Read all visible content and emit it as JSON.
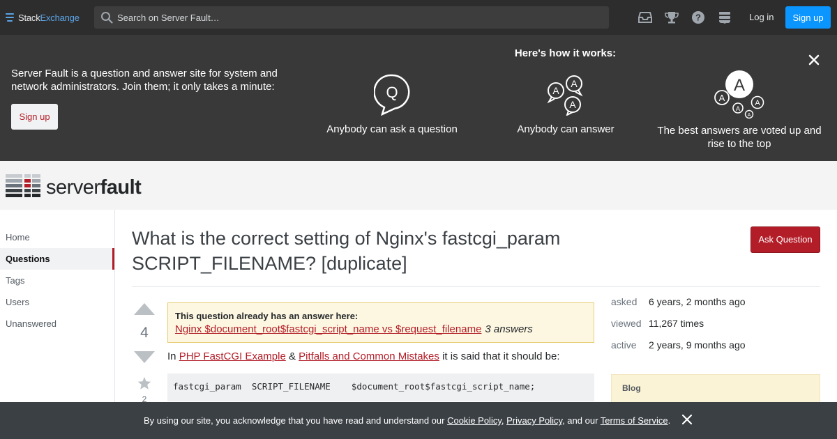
{
  "topbar": {
    "logo_stack": "Stack",
    "logo_exchange": "Exchange",
    "search_placeholder": "Search on Server Fault…",
    "icons": [
      "inbox-icon",
      "achievements-icon",
      "help-icon",
      "site-switcher-icon"
    ],
    "login_label": "Log in",
    "signup_label": "Sign up"
  },
  "hero": {
    "intro": "Server Fault is a question and answer site for system and network administrators. Join them; it only takes a minute:",
    "signup_label": "Sign up",
    "heading": "Here's how it works:",
    "steps": [
      {
        "icon": "ask-question-icon",
        "glyph": "Q",
        "label": "Anybody can ask a question"
      },
      {
        "icon": "answer-icon",
        "glyph": "A",
        "label": "Anybody can answer"
      },
      {
        "icon": "voted-answer-icon",
        "glyph": "A",
        "label": "The best answers are voted up and rise to the top"
      }
    ]
  },
  "site": {
    "name_light": "server",
    "name_bold": "fault"
  },
  "nav": {
    "items": [
      {
        "label": "Home",
        "active": false
      },
      {
        "label": "Questions",
        "active": true
      },
      {
        "label": "Tags",
        "active": false
      },
      {
        "label": "Users",
        "active": false
      },
      {
        "label": "Unanswered",
        "active": false
      }
    ]
  },
  "question": {
    "title": "What is the correct setting of Nginx's fastcgi_param SCRIPT_FILENAME? [duplicate]",
    "ask_button": "Ask Question",
    "votes": "4",
    "favorites": "2",
    "duplicate": {
      "heading": "This question already has an answer here:",
      "link": "Nginx $document_root$fastcgi_script_name vs $request_filename",
      "answers": "3 answers"
    },
    "body": {
      "prefix": "In",
      "link1": "PHP FastCGI Example",
      "amp": "&",
      "link2": "Pitfalls and Common Mistakes",
      "suffix": "it is said that it should be:"
    },
    "code": "fastcgi_param  SCRIPT_FILENAME    $document_root$fastcgi_script_name;"
  },
  "meta": {
    "asked_label": "asked",
    "asked_value": "6 years, 2 months ago",
    "viewed_label": "viewed",
    "viewed_value": "11,267 times",
    "active_label": "active",
    "active_value": "2 years, 9 months ago",
    "blog_heading": "Blog"
  },
  "cookie": {
    "text1": "By using our site, you acknowledge that you have read and understand our",
    "cookie_policy": "Cookie Policy",
    "comma": ",",
    "privacy_policy": "Privacy Policy",
    "text2": ", and our",
    "terms": "Terms of Service",
    "period": "."
  },
  "colors": {
    "topbar": "#2d2d2d",
    "hero": "#393939",
    "brand_red": "#b31d28",
    "primary_blue": "#0a95ff",
    "duplicate_bg": "#fdf7e2",
    "cookie_bg": "#3b4045"
  }
}
